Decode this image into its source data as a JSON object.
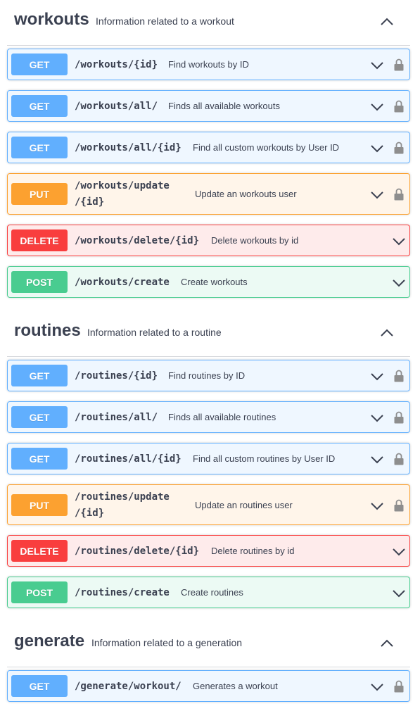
{
  "sections": [
    {
      "name": "workouts",
      "description": "Information related to a workout",
      "operations": [
        {
          "method": "GET",
          "path": "/workouts/{id}",
          "summary": "Find workouts by ID",
          "locked": true
        },
        {
          "method": "GET",
          "path": "/workouts/all/",
          "summary": "Finds all available workouts",
          "locked": true
        },
        {
          "method": "GET",
          "path": "/workouts/all/{id}",
          "summary": "Find all custom workouts by User ID",
          "locked": true
        },
        {
          "method": "PUT",
          "path_line1": "/workouts/update",
          "path_line2": "/{id}",
          "summary": "Update an workouts user",
          "locked": true
        },
        {
          "method": "DELETE",
          "path": "/workouts/delete/{id}",
          "summary": "Delete workouts by id",
          "locked": false
        },
        {
          "method": "POST",
          "path": "/workouts/create",
          "summary": "Create workouts",
          "locked": false
        }
      ]
    },
    {
      "name": "routines",
      "description": "Information related to a routine",
      "operations": [
        {
          "method": "GET",
          "path": "/routines/{id}",
          "summary": "Find routines by ID",
          "locked": true
        },
        {
          "method": "GET",
          "path": "/routines/all/",
          "summary": "Finds all available routines",
          "locked": true
        },
        {
          "method": "GET",
          "path": "/routines/all/{id}",
          "summary": "Find all custom routines by User ID",
          "locked": true
        },
        {
          "method": "PUT",
          "path_line1": "/routines/update",
          "path_line2": "/{id}",
          "summary": "Update an routines user",
          "locked": true
        },
        {
          "method": "DELETE",
          "path": "/routines/delete/{id}",
          "summary": "Delete routines by id",
          "locked": false
        },
        {
          "method": "POST",
          "path": "/routines/create",
          "summary": "Create routines",
          "locked": false
        }
      ]
    },
    {
      "name": "generate",
      "description": "Information related to a generation",
      "operations": [
        {
          "method": "GET",
          "path": "/generate/workout/",
          "summary": "Generates a workout",
          "locked": true
        }
      ]
    }
  ],
  "colors": {
    "get": "#61affe",
    "put": "#fca130",
    "delete": "#f93e3e",
    "post": "#49cc90"
  },
  "icons": {
    "collapse": "chevron-up-icon",
    "expand": "chevron-down-icon",
    "auth": "lock-icon"
  }
}
